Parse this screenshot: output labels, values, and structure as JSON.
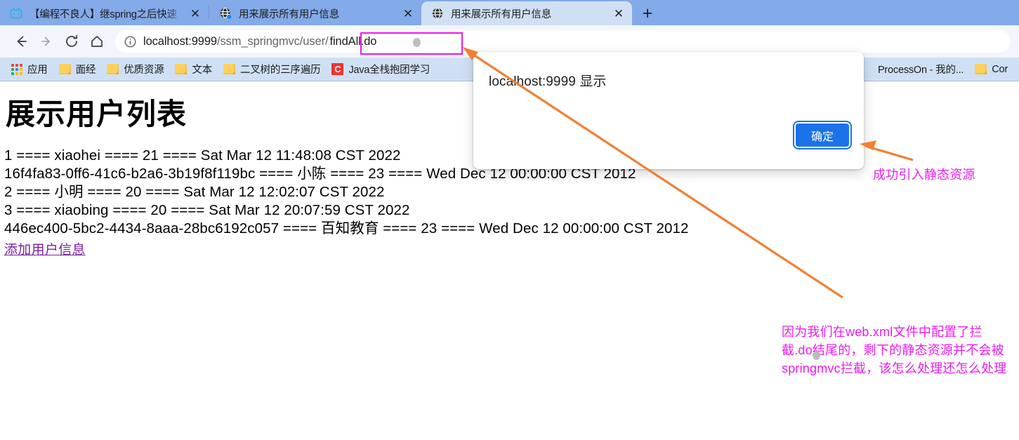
{
  "browser": {
    "tabs": [
      {
        "title": "【编程不良人】继spring之后快速",
        "favicon": "bilibili-tv-icon",
        "active": false,
        "close_label": "✕"
      },
      {
        "title": "用来展示所有用户信息",
        "favicon": "globe-icon",
        "active": false,
        "close_label": "✕"
      },
      {
        "title": "用来展示所有用户信息",
        "favicon": "globe-icon",
        "active": true,
        "close_label": "✕"
      }
    ],
    "new_tab_label": "+",
    "nav": {
      "back_label": "←",
      "forward_label": "→",
      "reload_label": "⟳",
      "home_label": "⌂"
    },
    "omnibox": {
      "info_icon": "page-info-icon",
      "url_host": "localhost:9999",
      "url_path": "/ssm_springmvc/user/",
      "url_highlight": "findAll.do",
      "full_url": "localhost:9999/ssm_springmvc/user/findAll.do",
      "highlight_color": "#e81ae8"
    },
    "bookmarks": [
      {
        "icon": "apps-grid-icon",
        "label": "应用"
      },
      {
        "icon": "folder-icon",
        "label": "面经"
      },
      {
        "icon": "folder-icon",
        "label": "优质资源"
      },
      {
        "icon": "folder-icon",
        "label": "文本"
      },
      {
        "icon": "folder-icon",
        "label": "二叉树的三序遍历"
      },
      {
        "icon": "letter-c-icon",
        "label": "Java全栈抱团学习"
      },
      {
        "icon": "none",
        "label": "ProcessOn - 我的..."
      },
      {
        "icon": "folder-icon",
        "label": "Cor"
      }
    ]
  },
  "page": {
    "title": "展示用户列表",
    "users": [
      "1 ==== xiaohei ==== 21 ==== Sat Mar 12 11:48:08 CST 2022",
      "16f4fa83-0ff6-41c6-b2a6-3b19f8f119bc ==== 小陈 ==== 23 ==== Wed Dec 12 00:00:00 CST 2012",
      "2 ==== 小明 ==== 20 ==== Sat Mar 12 12:02:07 CST 2022",
      "3 ==== xiaobing ==== 20 ==== Sat Mar 12 20:07:59 CST 2022",
      "446ec400-5bc2-4434-8aaa-28bc6192c057 ==== 百知教育 ==== 23 ==== Wed Dec 12 00:00:00 CST 2012"
    ],
    "add_user_link": "添加用户信息"
  },
  "dialog": {
    "title": "localhost:9999 显示",
    "ok_label": "确定",
    "button_color": "#1a73e8"
  },
  "annotations": {
    "color": "#ef1aef",
    "arrow_color": "#f08033",
    "top_note": "成功引入静态资源",
    "bottom_note": "因为我们在web.xml文件中配置了拦截.do结尾的，剩下的静态资源并不会被springmvc拦截，该怎么处理还怎么处理"
  }
}
